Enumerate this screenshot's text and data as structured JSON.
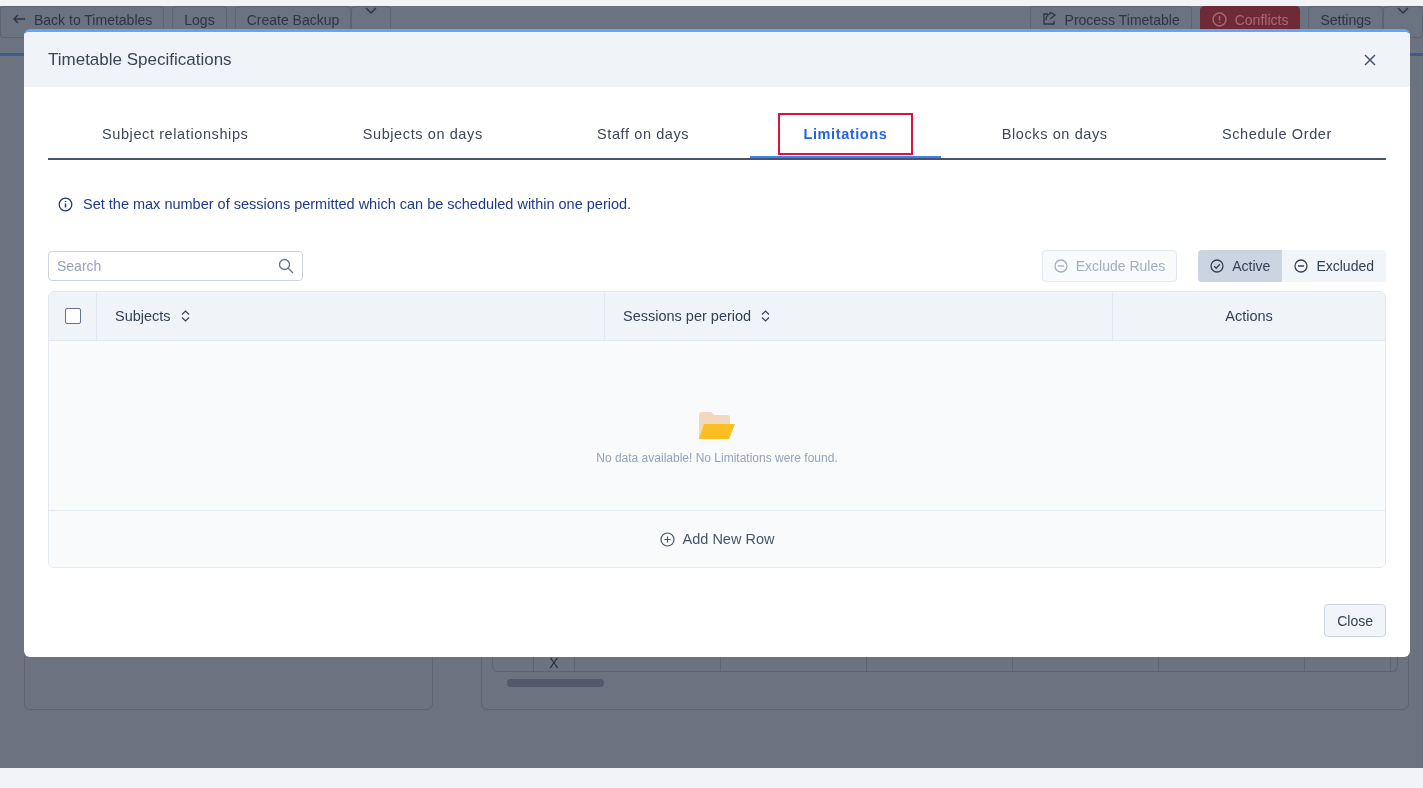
{
  "background": {
    "toolbar_left": [
      {
        "kind": "back",
        "label": "Back to Timetables"
      },
      {
        "kind": "plain",
        "label": "Logs"
      },
      {
        "kind": "plain",
        "label": "Create Backup"
      },
      {
        "kind": "caret"
      }
    ],
    "toolbar_right": [
      {
        "kind": "share",
        "label": "Process Timetable"
      },
      {
        "kind": "danger",
        "label": "Conflicts"
      },
      {
        "kind": "plain",
        "label": "Settings"
      },
      {
        "kind": "caret"
      }
    ],
    "grid_cell": "X"
  },
  "dialog": {
    "title": "Timetable Specifications",
    "tabs": [
      {
        "label": "Subject relationships",
        "selected": false
      },
      {
        "label": "Subjects on days",
        "selected": false
      },
      {
        "label": "Staff on days",
        "selected": false
      },
      {
        "label": "Limitations",
        "selected": true
      },
      {
        "label": "Blocks on days",
        "selected": false
      },
      {
        "label": "Schedule Order",
        "selected": false
      }
    ],
    "info": "Set the max number of sessions permitted which can be scheduled within one period.",
    "search": {
      "placeholder": "Search"
    },
    "exclude_button": {
      "label": "Exclude Rules",
      "disabled": true
    },
    "filter": [
      {
        "kind": "check",
        "label": "Active",
        "selected": true
      },
      {
        "kind": "minus",
        "label": "Excluded",
        "selected": false
      }
    ],
    "table": {
      "select_all_checked": false,
      "columns": [
        {
          "label": "Subjects",
          "sortable": true
        },
        {
          "label": "Sessions per period",
          "sortable": true
        },
        {
          "label": "Actions",
          "sortable": false
        }
      ],
      "empty_message": "No data available! No Limitations were found.",
      "add_row": "Add New Row"
    },
    "close_button": "Close"
  }
}
